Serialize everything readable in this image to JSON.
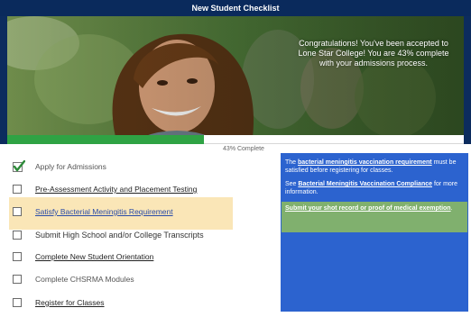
{
  "title": "New Student Checklist",
  "hero": {
    "message": "Congratulations! You've been accepted to Lone Star College! You are 43% complete with your admissions process."
  },
  "progress": {
    "percent": 43,
    "label": "43% Complete",
    "color": "#2fa344"
  },
  "checklist": [
    {
      "label": "Apply for Admissions",
      "state": "complete"
    },
    {
      "label": "Pre-Assessment Activity and Placement Testing",
      "state": "link"
    },
    {
      "label": "Satisfy Bacterial Meningitis Requirement",
      "state": "active"
    },
    {
      "label": "Submit High School and/or College Transcripts",
      "state": "pending"
    },
    {
      "label": "Complete New Student Orientation",
      "state": "link"
    },
    {
      "label": "Complete CHSRMA Modules",
      "state": "disabled"
    },
    {
      "label": "Register for Classes",
      "state": "link"
    }
  ],
  "info": {
    "p1_pre": "The ",
    "p1_link": "bacterial meningitis vaccination requirement",
    "p1_post": " must be satisfied before registering for classes.",
    "p2_pre": "See ",
    "p2_link": "Bacterial Meningitis Vaccination Compliance",
    "p2_post": " for more information.",
    "submit_link": "Submit your shot record or proof of medical exemption",
    "submit_post": "."
  },
  "colors": {
    "panel_blue": "#2c63cf",
    "highlight": "#fae6b7",
    "header": "#0a2a5c"
  }
}
